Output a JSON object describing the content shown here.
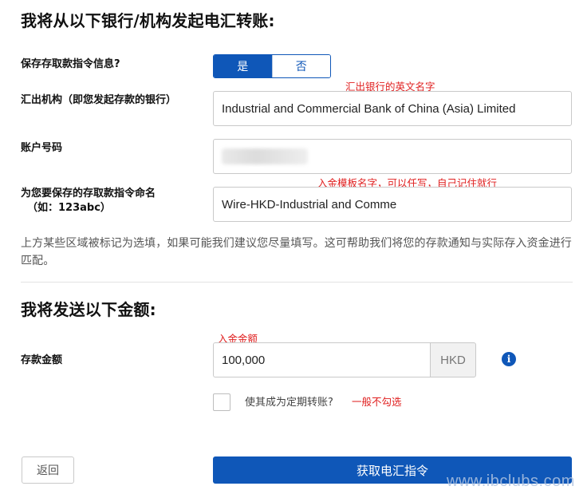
{
  "wire_form": {
    "title": "我将从以下银行/机构发起电汇转账:",
    "save_instructions": {
      "label": "保存存取款指令信息?",
      "yes": "是",
      "no": "否",
      "selected": "是"
    },
    "originating_bank": {
      "label": "汇出机构（即您发起存款的银行）",
      "value": "Industrial and Commercial Bank of China (Asia) Limited"
    },
    "account_number": {
      "label": "账户号码"
    },
    "instruction_name": {
      "label_line1": "为您要保存的存取款指令命名",
      "label_line2": "（如：123abc）",
      "value": "Wire-HKD-Industrial and Comme"
    },
    "notice": "上方某些区域被标记为选填，如果可能我们建议您尽量填写。这可帮助我们将您的存款通知与实际存入资金进行匹配。"
  },
  "amount_section": {
    "title": "我将发送以下金额:",
    "amount": {
      "label": "存款金额",
      "value": "100,000",
      "currency": "HKD"
    },
    "info_icon_glyph": "i",
    "recurring": {
      "label": "使其成为定期转账?",
      "checked": false
    }
  },
  "annotations": {
    "bank_hint": "汇出银行的英文名字",
    "name_hint": "入金模板名字，可以任写，自己记住就行",
    "amount_hint": "入金金额",
    "recurring_hint": "一般不勾选"
  },
  "actions": {
    "back": "返回",
    "submit": "获取电汇指令"
  },
  "watermark": "www.ibclubs.com",
  "colors": {
    "primary": "#0f57b8",
    "annotation": "#e02020"
  },
  "icons": {
    "info": "info-circle-icon"
  }
}
